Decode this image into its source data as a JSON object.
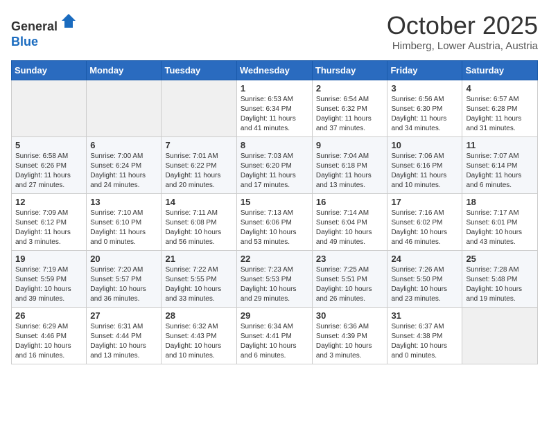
{
  "header": {
    "logo": {
      "line1": "General",
      "line2": "Blue"
    },
    "title": "October 2025",
    "subtitle": "Himberg, Lower Austria, Austria"
  },
  "weekdays": [
    "Sunday",
    "Monday",
    "Tuesday",
    "Wednesday",
    "Thursday",
    "Friday",
    "Saturday"
  ],
  "weeks": [
    [
      {
        "day": "",
        "sunrise": "",
        "sunset": "",
        "daylight": ""
      },
      {
        "day": "",
        "sunrise": "",
        "sunset": "",
        "daylight": ""
      },
      {
        "day": "",
        "sunrise": "",
        "sunset": "",
        "daylight": ""
      },
      {
        "day": "1",
        "sunrise": "Sunrise: 6:53 AM",
        "sunset": "Sunset: 6:34 PM",
        "daylight": "Daylight: 11 hours and 41 minutes."
      },
      {
        "day": "2",
        "sunrise": "Sunrise: 6:54 AM",
        "sunset": "Sunset: 6:32 PM",
        "daylight": "Daylight: 11 hours and 37 minutes."
      },
      {
        "day": "3",
        "sunrise": "Sunrise: 6:56 AM",
        "sunset": "Sunset: 6:30 PM",
        "daylight": "Daylight: 11 hours and 34 minutes."
      },
      {
        "day": "4",
        "sunrise": "Sunrise: 6:57 AM",
        "sunset": "Sunset: 6:28 PM",
        "daylight": "Daylight: 11 hours and 31 minutes."
      }
    ],
    [
      {
        "day": "5",
        "sunrise": "Sunrise: 6:58 AM",
        "sunset": "Sunset: 6:26 PM",
        "daylight": "Daylight: 11 hours and 27 minutes."
      },
      {
        "day": "6",
        "sunrise": "Sunrise: 7:00 AM",
        "sunset": "Sunset: 6:24 PM",
        "daylight": "Daylight: 11 hours and 24 minutes."
      },
      {
        "day": "7",
        "sunrise": "Sunrise: 7:01 AM",
        "sunset": "Sunset: 6:22 PM",
        "daylight": "Daylight: 11 hours and 20 minutes."
      },
      {
        "day": "8",
        "sunrise": "Sunrise: 7:03 AM",
        "sunset": "Sunset: 6:20 PM",
        "daylight": "Daylight: 11 hours and 17 minutes."
      },
      {
        "day": "9",
        "sunrise": "Sunrise: 7:04 AM",
        "sunset": "Sunset: 6:18 PM",
        "daylight": "Daylight: 11 hours and 13 minutes."
      },
      {
        "day": "10",
        "sunrise": "Sunrise: 7:06 AM",
        "sunset": "Sunset: 6:16 PM",
        "daylight": "Daylight: 11 hours and 10 minutes."
      },
      {
        "day": "11",
        "sunrise": "Sunrise: 7:07 AM",
        "sunset": "Sunset: 6:14 PM",
        "daylight": "Daylight: 11 hours and 6 minutes."
      }
    ],
    [
      {
        "day": "12",
        "sunrise": "Sunrise: 7:09 AM",
        "sunset": "Sunset: 6:12 PM",
        "daylight": "Daylight: 11 hours and 3 minutes."
      },
      {
        "day": "13",
        "sunrise": "Sunrise: 7:10 AM",
        "sunset": "Sunset: 6:10 PM",
        "daylight": "Daylight: 11 hours and 0 minutes."
      },
      {
        "day": "14",
        "sunrise": "Sunrise: 7:11 AM",
        "sunset": "Sunset: 6:08 PM",
        "daylight": "Daylight: 10 hours and 56 minutes."
      },
      {
        "day": "15",
        "sunrise": "Sunrise: 7:13 AM",
        "sunset": "Sunset: 6:06 PM",
        "daylight": "Daylight: 10 hours and 53 minutes."
      },
      {
        "day": "16",
        "sunrise": "Sunrise: 7:14 AM",
        "sunset": "Sunset: 6:04 PM",
        "daylight": "Daylight: 10 hours and 49 minutes."
      },
      {
        "day": "17",
        "sunrise": "Sunrise: 7:16 AM",
        "sunset": "Sunset: 6:02 PM",
        "daylight": "Daylight: 10 hours and 46 minutes."
      },
      {
        "day": "18",
        "sunrise": "Sunrise: 7:17 AM",
        "sunset": "Sunset: 6:01 PM",
        "daylight": "Daylight: 10 hours and 43 minutes."
      }
    ],
    [
      {
        "day": "19",
        "sunrise": "Sunrise: 7:19 AM",
        "sunset": "Sunset: 5:59 PM",
        "daylight": "Daylight: 10 hours and 39 minutes."
      },
      {
        "day": "20",
        "sunrise": "Sunrise: 7:20 AM",
        "sunset": "Sunset: 5:57 PM",
        "daylight": "Daylight: 10 hours and 36 minutes."
      },
      {
        "day": "21",
        "sunrise": "Sunrise: 7:22 AM",
        "sunset": "Sunset: 5:55 PM",
        "daylight": "Daylight: 10 hours and 33 minutes."
      },
      {
        "day": "22",
        "sunrise": "Sunrise: 7:23 AM",
        "sunset": "Sunset: 5:53 PM",
        "daylight": "Daylight: 10 hours and 29 minutes."
      },
      {
        "day": "23",
        "sunrise": "Sunrise: 7:25 AM",
        "sunset": "Sunset: 5:51 PM",
        "daylight": "Daylight: 10 hours and 26 minutes."
      },
      {
        "day": "24",
        "sunrise": "Sunrise: 7:26 AM",
        "sunset": "Sunset: 5:50 PM",
        "daylight": "Daylight: 10 hours and 23 minutes."
      },
      {
        "day": "25",
        "sunrise": "Sunrise: 7:28 AM",
        "sunset": "Sunset: 5:48 PM",
        "daylight": "Daylight: 10 hours and 19 minutes."
      }
    ],
    [
      {
        "day": "26",
        "sunrise": "Sunrise: 6:29 AM",
        "sunset": "Sunset: 4:46 PM",
        "daylight": "Daylight: 10 hours and 16 minutes."
      },
      {
        "day": "27",
        "sunrise": "Sunrise: 6:31 AM",
        "sunset": "Sunset: 4:44 PM",
        "daylight": "Daylight: 10 hours and 13 minutes."
      },
      {
        "day": "28",
        "sunrise": "Sunrise: 6:32 AM",
        "sunset": "Sunset: 4:43 PM",
        "daylight": "Daylight: 10 hours and 10 minutes."
      },
      {
        "day": "29",
        "sunrise": "Sunrise: 6:34 AM",
        "sunset": "Sunset: 4:41 PM",
        "daylight": "Daylight: 10 hours and 6 minutes."
      },
      {
        "day": "30",
        "sunrise": "Sunrise: 6:36 AM",
        "sunset": "Sunset: 4:39 PM",
        "daylight": "Daylight: 10 hours and 3 minutes."
      },
      {
        "day": "31",
        "sunrise": "Sunrise: 6:37 AM",
        "sunset": "Sunset: 4:38 PM",
        "daylight": "Daylight: 10 hours and 0 minutes."
      },
      {
        "day": "",
        "sunrise": "",
        "sunset": "",
        "daylight": ""
      }
    ]
  ]
}
